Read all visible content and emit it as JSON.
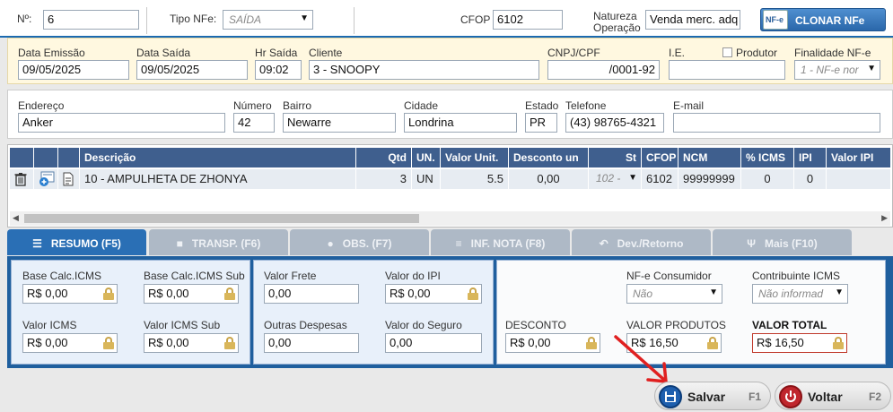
{
  "header": {
    "numero_label": "Nº:",
    "numero_value": "6",
    "tipo_label": "Tipo NFe:",
    "tipo_value": "SAÍDA",
    "cfop_label": "CFOP",
    "cfop_value": "6102",
    "natureza_label_1": "Natureza",
    "natureza_label_2": "Operação",
    "natureza_value": "Venda merc. adq",
    "nfe_badge": "NF-e",
    "clonar_label": "CLONAR NFe"
  },
  "emissao": {
    "data_emissao_label": "Data Emissão",
    "data_emissao_value": "09/05/2025",
    "data_saida_label": "Data Saída",
    "data_saida_value": "09/05/2025",
    "hr_saida_label": "Hr Saída",
    "hr_saida_value": "09:02",
    "cliente_label": "Cliente",
    "cliente_value": "3 - SNOOPY",
    "cnpj_label": "CNPJ/CPF",
    "cnpj_value": "/0001-92",
    "ie_label": "I.E.",
    "ie_value": "",
    "produtor_label": "Produtor",
    "finalidade_label": "Finalidade NF-e",
    "finalidade_value": "1 - NF-e nor"
  },
  "endereco": {
    "endereco_label": "Endereço",
    "endereco_value": "Anker",
    "numero_label": "Número",
    "numero_value": "42",
    "bairro_label": "Bairro",
    "bairro_value": "Newarre",
    "cidade_label": "Cidade",
    "cidade_value": "Londrina",
    "estado_label": "Estado",
    "estado_value": "PR",
    "telefone_label": "Telefone",
    "telefone_value": "(43) 98765-4321",
    "email_label": "E-mail",
    "email_value": ""
  },
  "grid": {
    "columns": [
      "Descrição",
      "Qtd",
      "UN.",
      "Valor Unit.",
      "Desconto un",
      "St",
      "CFOP",
      "NCM",
      "% ICMS",
      "IPI",
      "Valor IPI"
    ],
    "row": {
      "descricao": "10 - AMPULHETA DE ZHONYA",
      "qtd": "3",
      "un": "UN",
      "valor_unit": "5.5",
      "desconto": "0,00",
      "st": "102 -",
      "cfop": "6102",
      "ncm": "99999999",
      "icms": "0",
      "ipi": "0",
      "valor_ipi": ""
    }
  },
  "tabs": [
    {
      "label": "RESUMO (F5)",
      "icon": "list-icon"
    },
    {
      "label": "TRANSP. (F6)",
      "icon": "truck-icon"
    },
    {
      "label": "OBS. (F7)",
      "icon": "speech-bubble-icon"
    },
    {
      "label": "INF. NOTA (F8)",
      "icon": "database-icon"
    },
    {
      "label": "Dev./Retorno",
      "icon": "return-arrow-icon"
    },
    {
      "label": "Mais (F10)",
      "icon": "fork-icon"
    }
  ],
  "resumo": {
    "base_calc_icms_label": "Base Calc.ICMS",
    "base_calc_icms_value": "R$ 0,00",
    "base_calc_icms_sub_label": "Base Calc.ICMS Sub",
    "base_calc_icms_sub_value": "R$ 0,00",
    "valor_icms_label": "Valor ICMS",
    "valor_icms_value": "R$ 0,00",
    "valor_icms_sub_label": "Valor ICMS Sub",
    "valor_icms_sub_value": "R$ 0,00",
    "valor_frete_label": "Valor Frete",
    "valor_frete_value": "0,00",
    "valor_ipi_label": "Valor do IPI",
    "valor_ipi_value": "R$ 0,00",
    "outras_despesas_label": "Outras Despesas",
    "outras_despesas_value": "0,00",
    "valor_seguro_label": "Valor do Seguro",
    "valor_seguro_value": "0,00",
    "nfe_consumidor_label": "NF-e Consumidor",
    "nfe_consumidor_value": "Não",
    "contribuinte_label": "Contribuinte ICMS",
    "contribuinte_value": "Não informad",
    "desconto_label": "DESCONTO",
    "desconto_value": "R$ 0,00",
    "valor_produtos_label": "VALOR PRODUTOS",
    "valor_produtos_value": "R$ 16,50",
    "valor_total_label": "VALOR TOTAL",
    "valor_total_value": "R$ 16,50"
  },
  "footer": {
    "salvar_label": "Salvar",
    "salvar_key": "F1",
    "voltar_label": "Voltar",
    "voltar_key": "F2"
  },
  "colors": {
    "accent": "#2a6fb5",
    "header_grid": "#3f5f8e",
    "total_border": "#c0392b",
    "annotation_arrow": "#e02020"
  }
}
